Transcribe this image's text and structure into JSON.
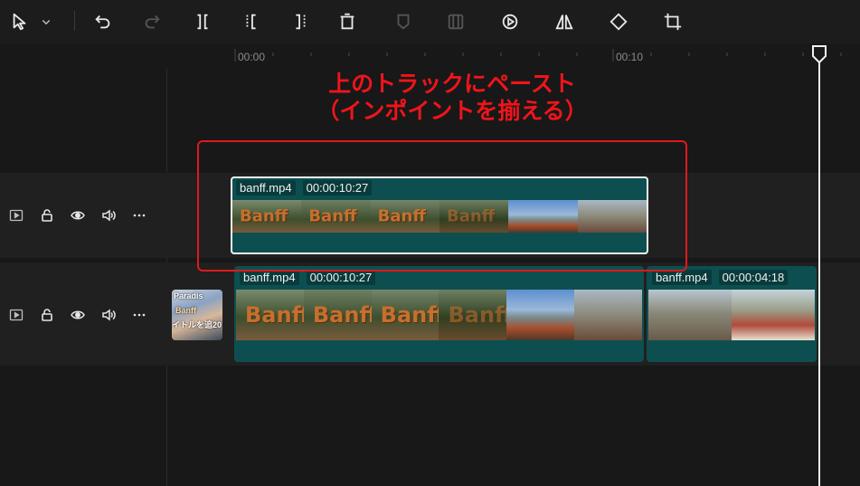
{
  "toolbar": {
    "icons": [
      "cursor-select-icon",
      "chevron-down-icon",
      "undo-icon",
      "redo-icon",
      "split-icon",
      "split-left-icon",
      "split-right-icon",
      "delete-icon",
      "marker-icon",
      "freeze-frame-icon",
      "play-circle-icon",
      "mirror-icon",
      "rotate-icon",
      "crop-icon"
    ]
  },
  "ruler": {
    "labels": [
      "00:00",
      "00:10"
    ]
  },
  "annotation": {
    "line1": "上のトラックにペースト",
    "line2": "（インポイントを揃える）",
    "color": "#f0141a"
  },
  "tracks": {
    "upper": {
      "clip": {
        "name": "banff.mp4",
        "duration": "00:00:10:27",
        "title_word": "Banff"
      }
    },
    "lower": {
      "thumb_text": {
        "top": "Paradis",
        "mid": "Banff",
        "bottom": "イトルを追20"
      },
      "clip1": {
        "name": "banff.mp4",
        "duration": "00:00:10:27",
        "title_word": "Banff"
      },
      "clip2": {
        "name": "banff.mp4",
        "duration": "00:00:04:18"
      }
    }
  },
  "colors": {
    "clip_teal": "#0d4f50",
    "annotation_red": "#e0191b",
    "playhead": "#f2f2f2"
  }
}
